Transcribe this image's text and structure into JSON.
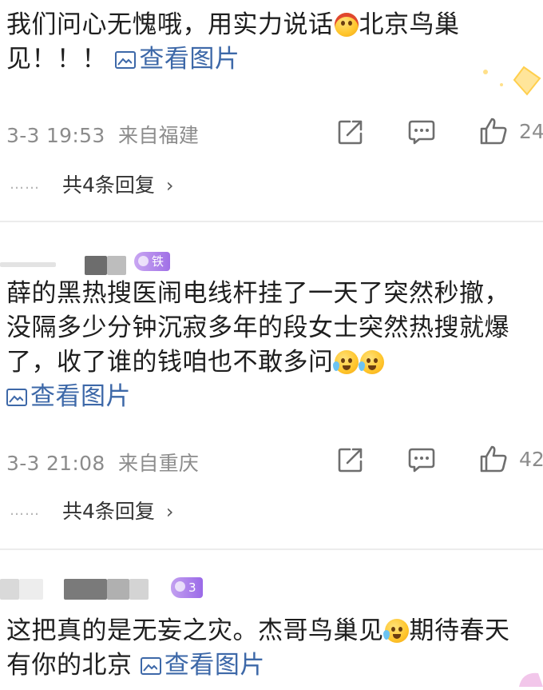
{
  "comments": [
    {
      "text_a": "我们问心无愧哦，用实力说话",
      "text_b": "北京鸟巢见！！！",
      "view_images": "查看图片",
      "time": "3-3 19:53",
      "location": "来自福建",
      "likes": "24",
      "replies": "共4条回复"
    },
    {
      "badge": "铁粉1",
      "text": "薛的黑热搜医闹电线杆挂了一天了突然秒撤，没隔多少分钟沉寂多年的段女士突然热搜就爆了，收了谁的钱咱也不敢多问",
      "view_images": "查看图片",
      "time": "3-3 21:08",
      "location": "来自重庆",
      "likes": "42",
      "replies": "共4条回复"
    },
    {
      "badge": "3",
      "text_a": "这把真的是无妄之灾。杰哥鸟巢见",
      "text_b": "期待春天有你的北京",
      "view_images": "查看图片"
    }
  ],
  "ui": {
    "dots": "……",
    "chevron": "›"
  },
  "icons": [
    "share-icon",
    "comment-icon",
    "like-icon",
    "image-icon",
    "emoji-hat",
    "emoji-tear"
  ],
  "colors": {
    "link": "#3d68a8",
    "meta": "#8c8c8c",
    "badge": "#a070e6",
    "divider": "#ececec"
  }
}
